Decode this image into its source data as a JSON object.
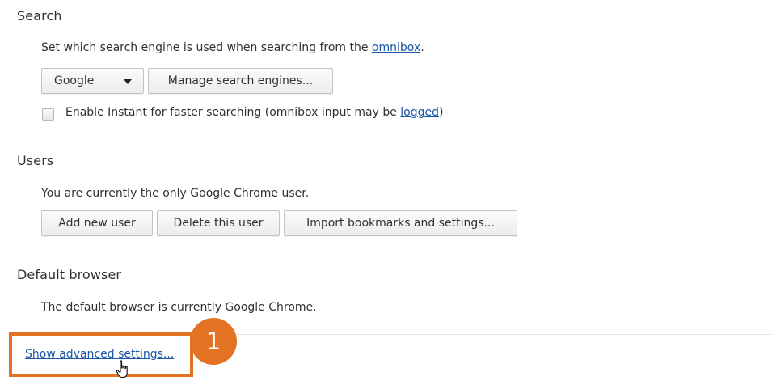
{
  "search": {
    "title": "Search",
    "description_prefix": "Set which search engine is used when searching from the ",
    "omnibox_link": "omnibox",
    "description_suffix": ".",
    "engine_selected": "Google",
    "manage_button": "Manage search engines...",
    "instant_label_prefix": "Enable Instant for faster searching (omnibox input may be ",
    "logged_link": "logged",
    "instant_label_suffix": ")",
    "instant_checked": false
  },
  "users": {
    "title": "Users",
    "description": "You are currently the only Google Chrome user.",
    "add_button": "Add new user",
    "delete_button": "Delete this user",
    "import_button": "Import bookmarks and settings..."
  },
  "default_browser": {
    "title": "Default browser",
    "description": "The default browser is currently Google Chrome."
  },
  "advanced": {
    "link": "Show advanced settings..."
  },
  "annotation": {
    "step_number": "1",
    "color": "#e37222"
  },
  "colors": {
    "link": "#1a55a8"
  }
}
